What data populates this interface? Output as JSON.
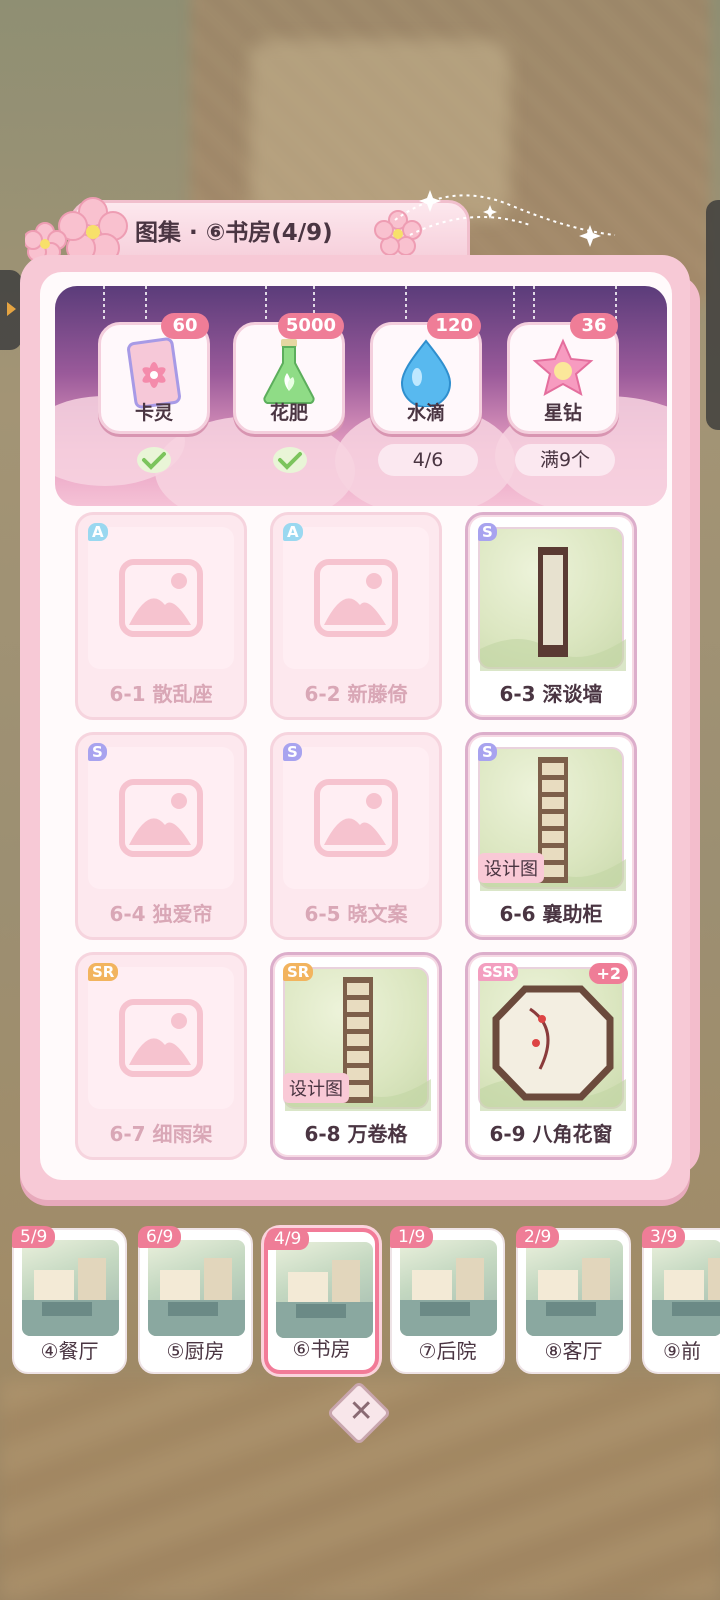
{
  "header": {
    "title": "图集 · ⑥书房(4/9)"
  },
  "rewards": [
    {
      "label": "卡灵",
      "count": "60",
      "icon": "card-spirit-icon",
      "status": "check"
    },
    {
      "label": "花肥",
      "count": "5000",
      "icon": "fertilizer-flask-icon",
      "status": "check"
    },
    {
      "label": "水滴",
      "count": "120",
      "icon": "water-drop-icon",
      "status": "4/6"
    },
    {
      "label": "星钻",
      "count": "36",
      "icon": "star-diamond-icon",
      "status": "满9个"
    }
  ],
  "items": [
    {
      "rarity": "A",
      "name": "6-1 散乱座",
      "owned": false
    },
    {
      "rarity": "A",
      "name": "6-2 新藤倚",
      "owned": false
    },
    {
      "rarity": "S",
      "name": "6-3 深谈墙",
      "owned": true
    },
    {
      "rarity": "S",
      "name": "6-4 独爱帘",
      "owned": false
    },
    {
      "rarity": "S",
      "name": "6-5 晓文案",
      "owned": false
    },
    {
      "rarity": "S",
      "name": "6-6 襄助柜",
      "owned": true,
      "tag": "设计图"
    },
    {
      "rarity": "SR",
      "name": "6-7 细雨架",
      "owned": false
    },
    {
      "rarity": "SR",
      "name": "6-8 万卷格",
      "owned": true,
      "tag": "设计图"
    },
    {
      "rarity": "SSR",
      "name": "6-9 八角花窗",
      "owned": true,
      "extra": "+2"
    }
  ],
  "rooms": [
    {
      "progress": "5/9",
      "label": "④餐厅"
    },
    {
      "progress": "6/9",
      "label": "⑤厨房"
    },
    {
      "progress": "4/9",
      "label": "⑥书房",
      "active": true
    },
    {
      "progress": "1/9",
      "label": "⑦后院"
    },
    {
      "progress": "2/9",
      "label": "⑧客厅"
    },
    {
      "progress": "3/9",
      "label": "⑨前"
    }
  ],
  "colors": {
    "accent": "#ef7d97",
    "panel": "#f7c9d6",
    "text": "#4a3542"
  },
  "close": {
    "icon": "close-icon"
  }
}
